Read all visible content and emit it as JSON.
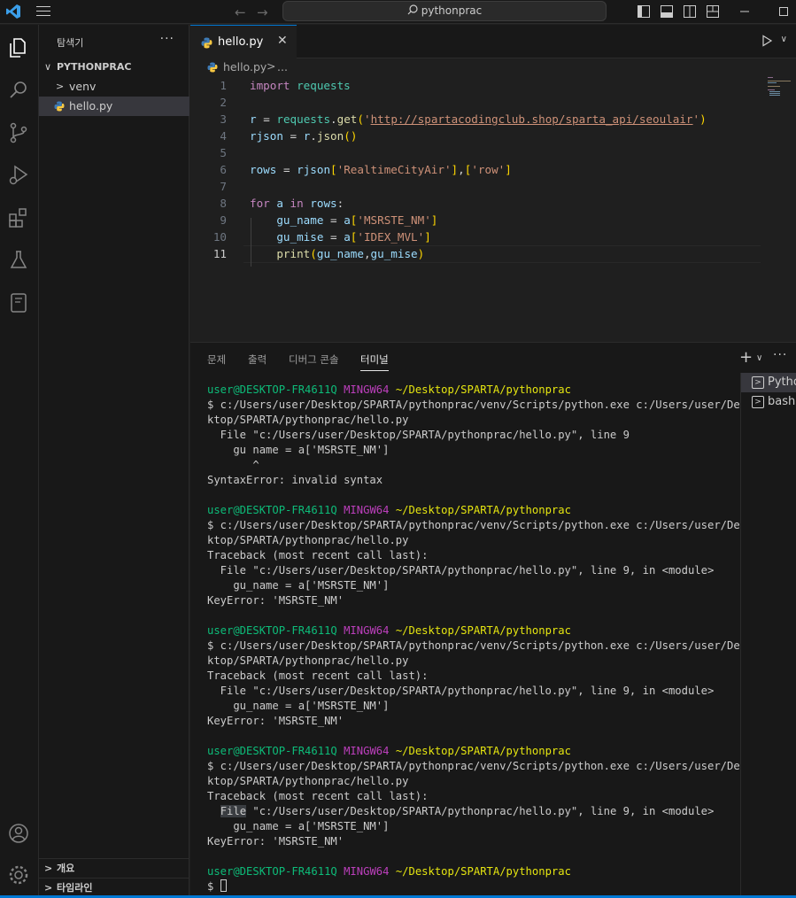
{
  "titlebar": {
    "search_text": "pythonprac"
  },
  "sidebar": {
    "header": "탐색기",
    "more": "···",
    "project": "PYTHONPRAC",
    "items": [
      {
        "label": "venv",
        "type": "folder"
      },
      {
        "label": "hello.py",
        "type": "file",
        "selected": true
      }
    ],
    "sections": [
      "개요",
      "타임라인"
    ]
  },
  "editor": {
    "tab_label": "hello.py",
    "breadcrumb": [
      "hello.py",
      "..."
    ],
    "current_line": 11,
    "line_numbers": [
      "1",
      "2",
      "3",
      "4",
      "5",
      "6",
      "7",
      "8",
      "9",
      "10",
      "11"
    ]
  },
  "panel": {
    "tabs": [
      "문제",
      "출력",
      "디버그 콘솔",
      "터미널"
    ],
    "active_tab": "터미널",
    "terminals": [
      "Python",
      "bash"
    ],
    "prompt": {
      "user": "user@DESKTOP-FR4611Q",
      "shell": "MINGW64",
      "path": "~/Desktop/SPARTA/pythonprac"
    },
    "output": [
      "$ c:/Users/user/Desktop/SPARTA/pythonprac/venv/Scripts/python.exe c:/Users/user/Des",
      "ktop/SPARTA/pythonprac/hello.py",
      "  File \"c:/Users/user/Desktop/SPARTA/pythonprac/hello.py\", line 9",
      "    gu name = a['MSRSTE_NM']",
      "       ^",
      "SyntaxError: invalid syntax",
      "Traceback (most recent call last):",
      "  File \"c:/Users/user/Desktop/SPARTA/pythonprac/hello.py\", line 9, in <module>",
      "    gu_name = a['MSRSTE_NM']",
      "KeyError: 'MSRSTE_NM'",
      "File",
      " \"c:/Users/user/Desktop/SPARTA/pythonprac/hello.py\", line 9, in <module>",
      "$ "
    ]
  },
  "colors": {
    "accent": "#0078d4",
    "editor_bg": "#1f1f1f",
    "panel_bg": "#181818",
    "term_green": "#0dbc79",
    "term_magenta": "#bc3fbc",
    "term_yellow": "#e5e510"
  }
}
